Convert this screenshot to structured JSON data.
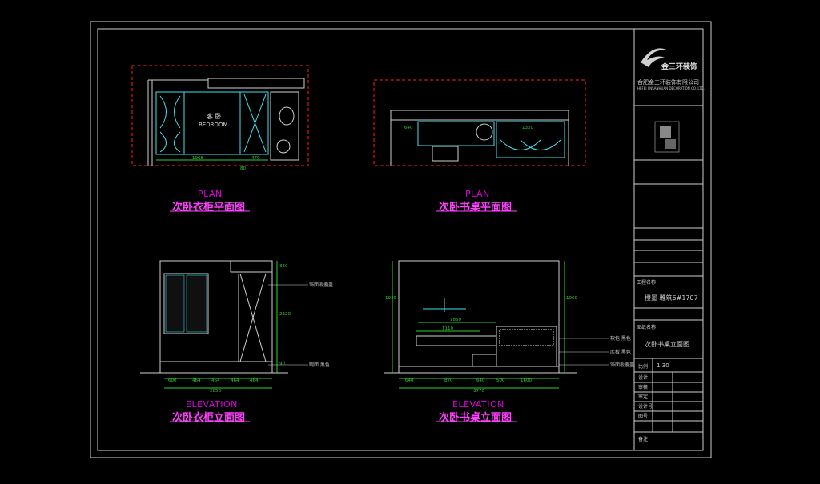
{
  "drawings": [
    {
      "title_en": "PLAN",
      "title_cn": "次卧衣柜平面图",
      "room_cn": "客 卧",
      "room_en": "BEDROOM",
      "dims": [
        "1968",
        "470",
        "80"
      ]
    },
    {
      "title_en": "PLAN",
      "title_cn": "次卧书桌平面图",
      "dims": [
        "640",
        "1320"
      ]
    },
    {
      "title_en": "ELEVATION",
      "title_cn": "次卧衣柜立面图",
      "notes": [
        "饰面板覆盖",
        "踢面 黑色"
      ],
      "dims_bottom": [
        "600",
        "464",
        "464",
        "464",
        "464"
      ],
      "total": "2858",
      "dims_side": [
        "360",
        "2320",
        "90"
      ]
    },
    {
      "title_en": "ELEVATION",
      "title_cn": "次卧书桌立面图",
      "notes": [
        "软包 黑色",
        "库板 黑色",
        "饰面板覆盖"
      ],
      "dims_top": [
        "1850",
        "1110"
      ],
      "dims_bottom": [
        "640",
        "870",
        "640",
        "500",
        "1600"
      ],
      "total": "3770",
      "dims_side": [
        "1930",
        "1060"
      ]
    }
  ],
  "title_block": {
    "company_logo_text": "金三环装饰",
    "company_cn": "合肥金三环装饰有限公司",
    "company_en": "HEFEI JINSANHUAN DECORATION CO.,LTD.",
    "project_label": "工程名称",
    "project_value": "橙墨 雅筑6#1707",
    "drawing_label": "图纸名称",
    "drawing_value": "次卧书桌立面图",
    "scale_label": "比例",
    "scale_value": "1:30",
    "rows": [
      "设计",
      "审核",
      "审定",
      "设计号",
      "图号"
    ],
    "remark_label": "备注"
  },
  "colors": {
    "frame": "#cfcfcf",
    "dash_red": "#ff2020",
    "cyan": "#40e0f0",
    "green": "#30d030",
    "magenta": "#ff40ff"
  }
}
